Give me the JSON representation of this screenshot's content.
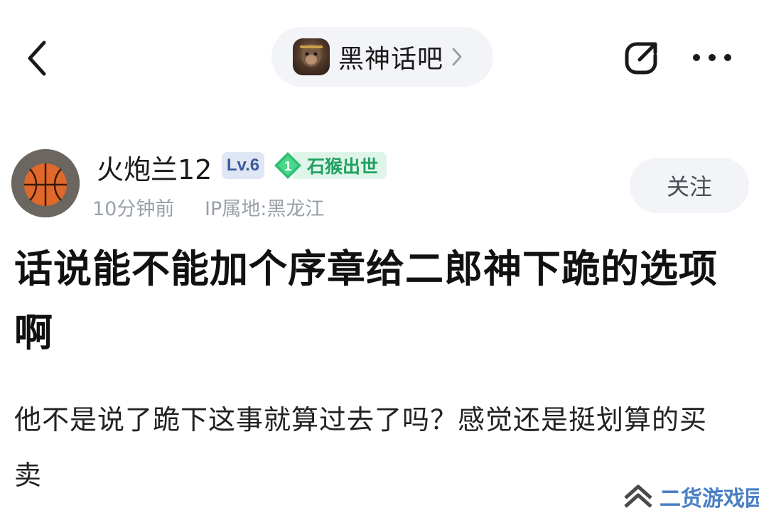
{
  "header": {
    "forum_name": "黑神话吧"
  },
  "author": {
    "name": "火炮兰12",
    "level": "Lv.6",
    "title_number": "1",
    "title": "石猴出世",
    "time": "10分钟前",
    "ip": "IP属地:黑龙江",
    "follow_label": "关注"
  },
  "post": {
    "title": "话说能不能加个序章给二郎神下跪的选项啊",
    "body": "他不是说了跪下这事就算过去了吗？感觉还是挺划算的买卖"
  },
  "watermark": {
    "text": "二货游戏园"
  },
  "colors": {
    "badge_green": "#21a060",
    "badge_blue": "#3d5a9a",
    "watermark_blue": "#4a7fc4"
  }
}
